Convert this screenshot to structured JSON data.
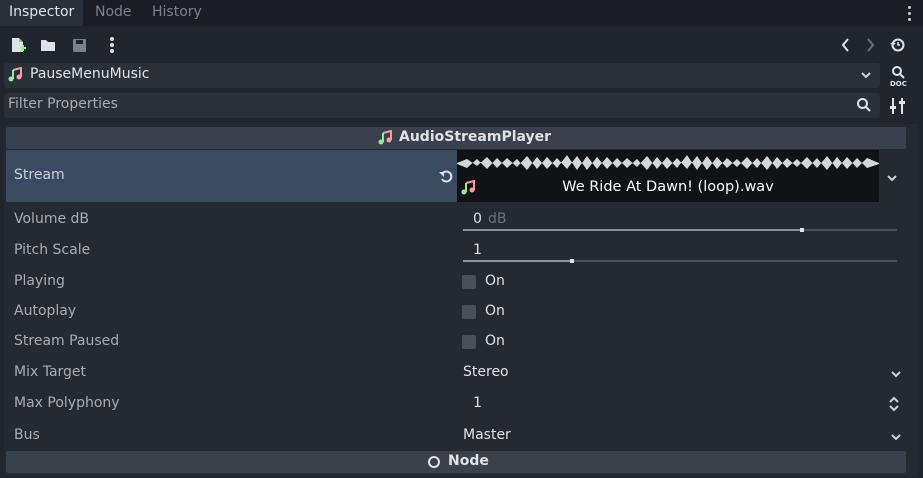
{
  "tabs": [
    {
      "label": "Inspector",
      "active": true
    },
    {
      "label": "Node",
      "active": false
    },
    {
      "label": "History",
      "active": false
    }
  ],
  "toolbar": {
    "icons": [
      "new-resource-icon",
      "open-folder-icon",
      "save-icon",
      "more-vert-icon",
      "back-icon",
      "forward-icon",
      "history-icon"
    ]
  },
  "node_selector": {
    "name": "PauseMenuMusic",
    "icon": "audio-stream-player-icon"
  },
  "filter": {
    "placeholder": "Filter Properties"
  },
  "section_header": {
    "label": "AudioStreamPlayer"
  },
  "properties": {
    "stream": {
      "label": "Stream",
      "value": "We Ride At Dawn! (loop).wav"
    },
    "volume_db": {
      "label": "Volume dB",
      "value": "0",
      "unit": "dB",
      "slider_fraction": 0.78
    },
    "pitch_scale": {
      "label": "Pitch Scale",
      "value": "1",
      "slider_fraction": 0.25
    },
    "playing": {
      "label": "Playing",
      "checkbox_label": "On",
      "checked": false
    },
    "autoplay": {
      "label": "Autoplay",
      "checkbox_label": "On",
      "checked": false
    },
    "stream_paused": {
      "label": "Stream Paused",
      "checkbox_label": "On",
      "checked": false
    },
    "mix_target": {
      "label": "Mix Target",
      "value": "Stereo"
    },
    "max_polyphony": {
      "label": "Max Polyphony",
      "value": "1"
    },
    "bus": {
      "label": "Bus",
      "value": "Master"
    }
  },
  "node_section": {
    "label": "Node"
  },
  "colors": {
    "accent_green": "#8eef97",
    "accent_orange": "#fc9c9c",
    "selected_row": "#3a4b60"
  }
}
